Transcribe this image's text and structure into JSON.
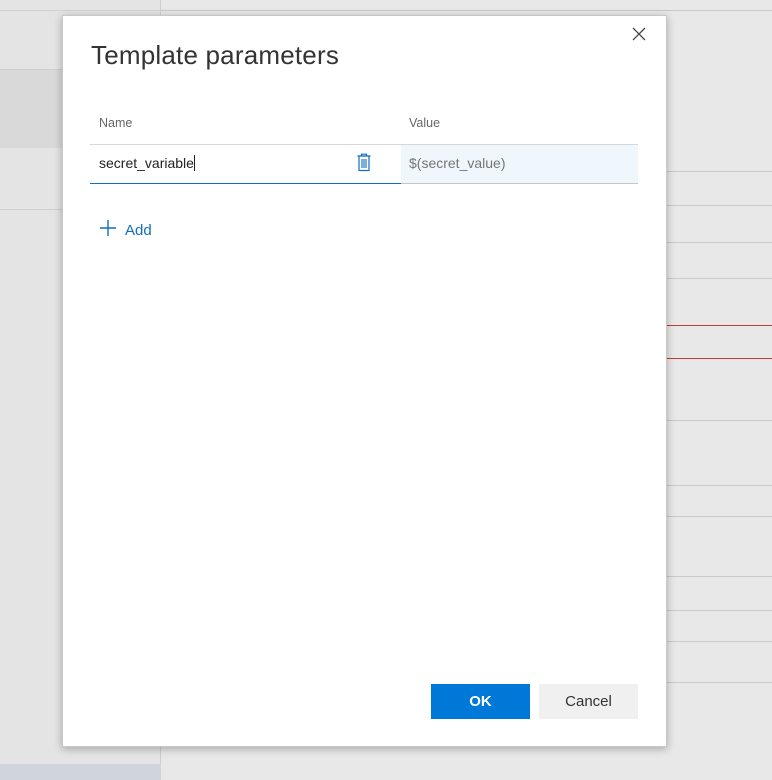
{
  "dialog": {
    "title": "Template parameters",
    "close_icon": "close-icon",
    "columns": {
      "name_header": "Name",
      "value_header": "Value"
    },
    "parameters": [
      {
        "name": "secret_variable",
        "value_placeholder": "$(secret_value)",
        "delete_icon": "trash-icon"
      }
    ],
    "add_button": {
      "icon": "plus-icon",
      "label": "Add"
    },
    "ok_label": "OK",
    "cancel_label": "Cancel"
  },
  "colors": {
    "primary": "#0078d7",
    "link": "#106ebe",
    "value_field_bg": "#eff6fc",
    "overlay_bg": "#e6e6e6",
    "error_line": "#c33b3b"
  }
}
